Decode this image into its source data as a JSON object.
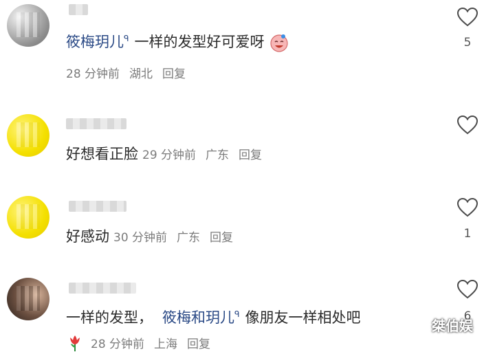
{
  "comments": [
    {
      "user_tag": "筱梅玥儿",
      "text_after_tag": "一样的发型好可爱呀",
      "emoji": "laughing-face-emoji",
      "time": "28 分钟前",
      "location": "湖北",
      "reply": "回复",
      "likes": "5"
    },
    {
      "text": "好想看正脸",
      "time": "29 分钟前",
      "location": "广东",
      "reply": "回复",
      "likes": ""
    },
    {
      "text": "好感动",
      "time": "30 分钟前",
      "location": "广东",
      "reply": "回复",
      "likes": "1"
    },
    {
      "text_before_tag": "一样的发型，",
      "user_tag": "筱梅和玥儿",
      "text_after_tag": "像朋友一样相处吧",
      "emoji": "tulip-emoji",
      "time": "28 分钟前",
      "location": "上海",
      "reply": "回复",
      "likes": "6"
    }
  ],
  "watermark": "桀伯娱",
  "colors": {
    "mention": "#2b4a86",
    "meta": "#7b7b7b",
    "text": "#2a2a2a"
  }
}
